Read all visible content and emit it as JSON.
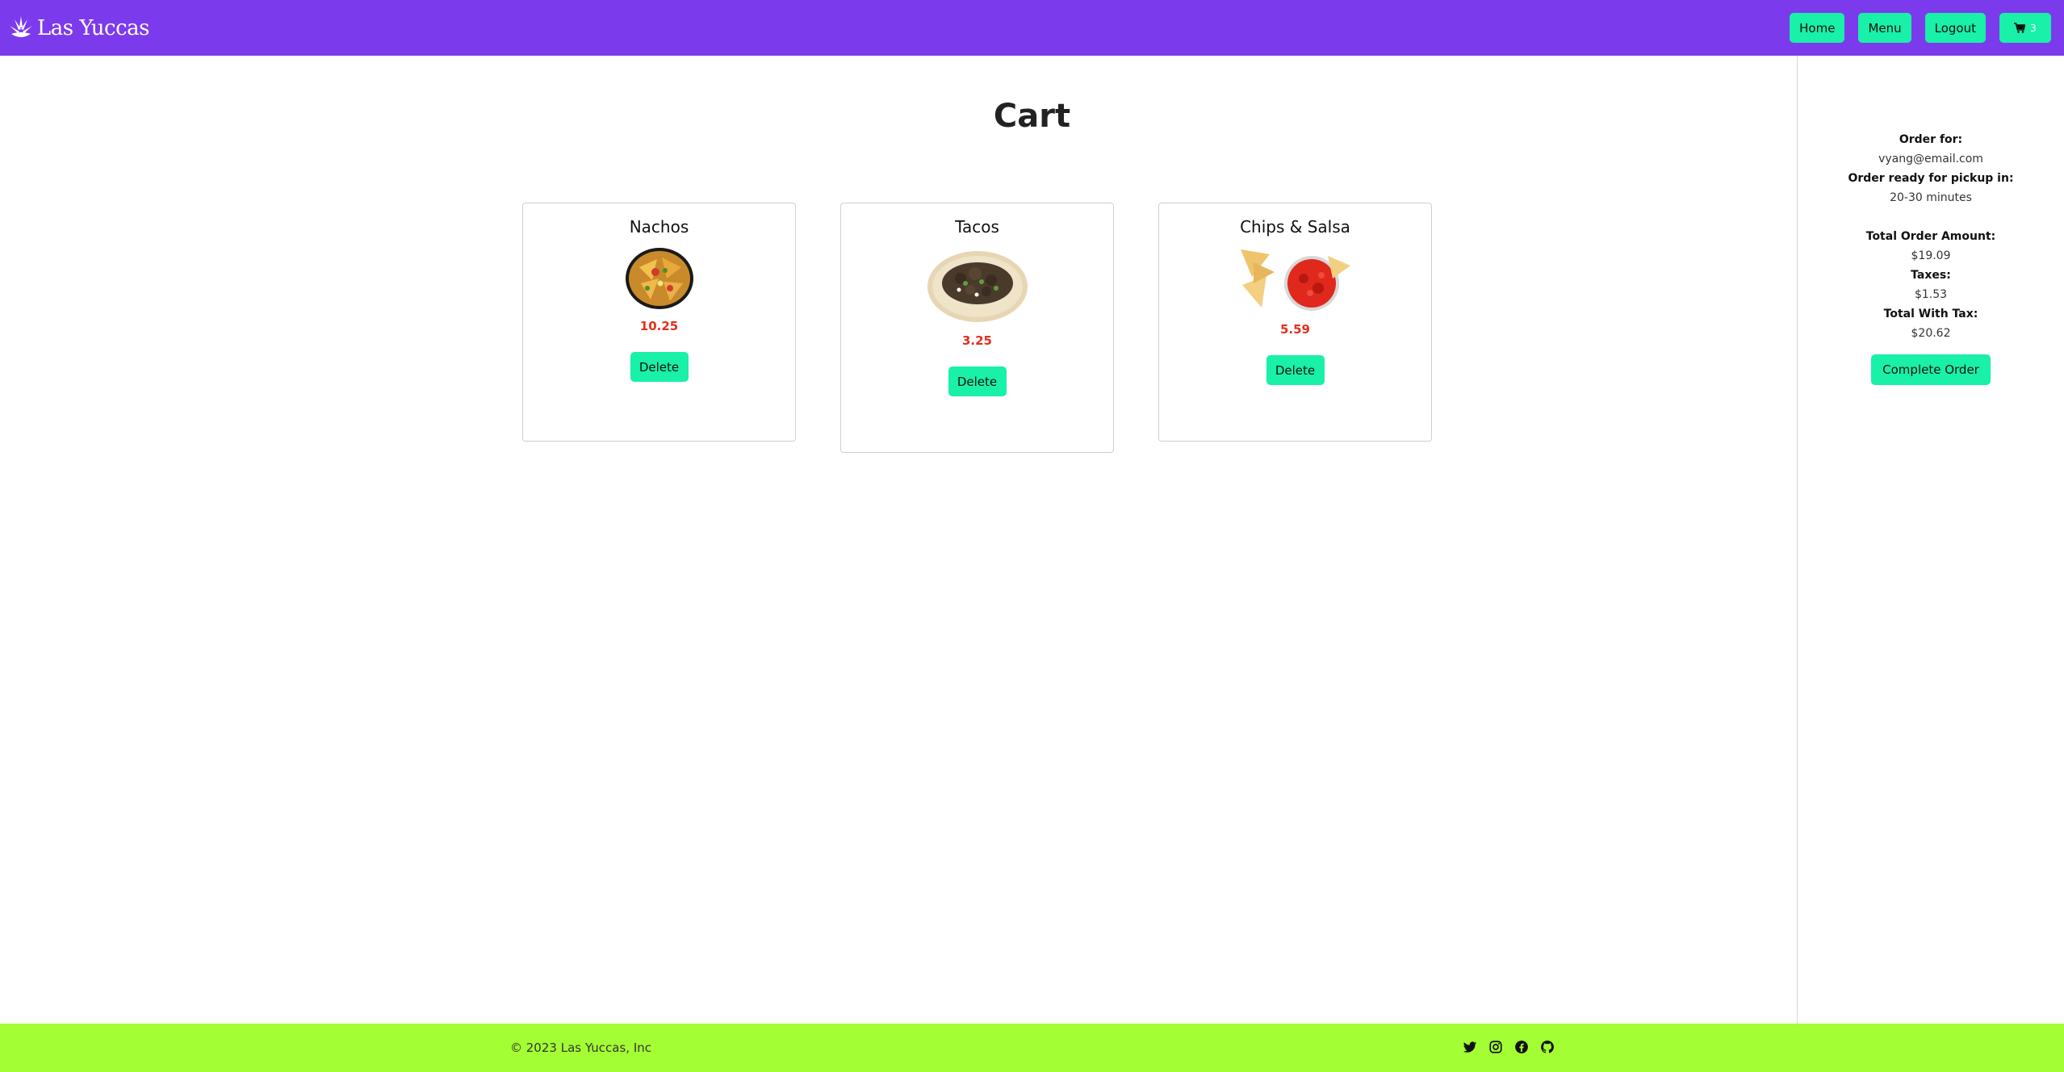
{
  "header": {
    "brand": "Las Yuccas",
    "nav": {
      "home": "Home",
      "menu": "Menu",
      "logout": "Logout",
      "cart_count": "3"
    }
  },
  "main": {
    "title": "Cart",
    "items": [
      {
        "name": "Nachos",
        "price": "10.25",
        "delete_label": "Delete",
        "image_icon": "nachos-image"
      },
      {
        "name": "Tacos",
        "price": "3.25",
        "delete_label": "Delete",
        "image_icon": "tacos-image"
      },
      {
        "name": "Chips & Salsa",
        "price": "5.59",
        "delete_label": "Delete",
        "image_icon": "chips-salsa-image"
      }
    ]
  },
  "sidebar": {
    "order_for_label": "Order for:",
    "order_for_value": "vyang@email.com",
    "ready_label": "Order ready for pickup in:",
    "ready_value": "20-30 minutes",
    "total_label": "Total Order Amount:",
    "total_value": "$19.09",
    "taxes_label": "Taxes:",
    "taxes_value": "$1.53",
    "total_tax_label": "Total With Tax:",
    "total_tax_value": "$20.62",
    "complete_label": "Complete Order"
  },
  "footer": {
    "copyright": "© 2023 Las Yuccas, Inc",
    "social_icons": [
      "twitter-icon",
      "instagram-icon",
      "facebook-icon",
      "github-icon"
    ]
  },
  "colors": {
    "navbar": "#7c3aed",
    "button": "#19f0a8",
    "price": "#e0301e",
    "footer": "#a3ff33"
  }
}
